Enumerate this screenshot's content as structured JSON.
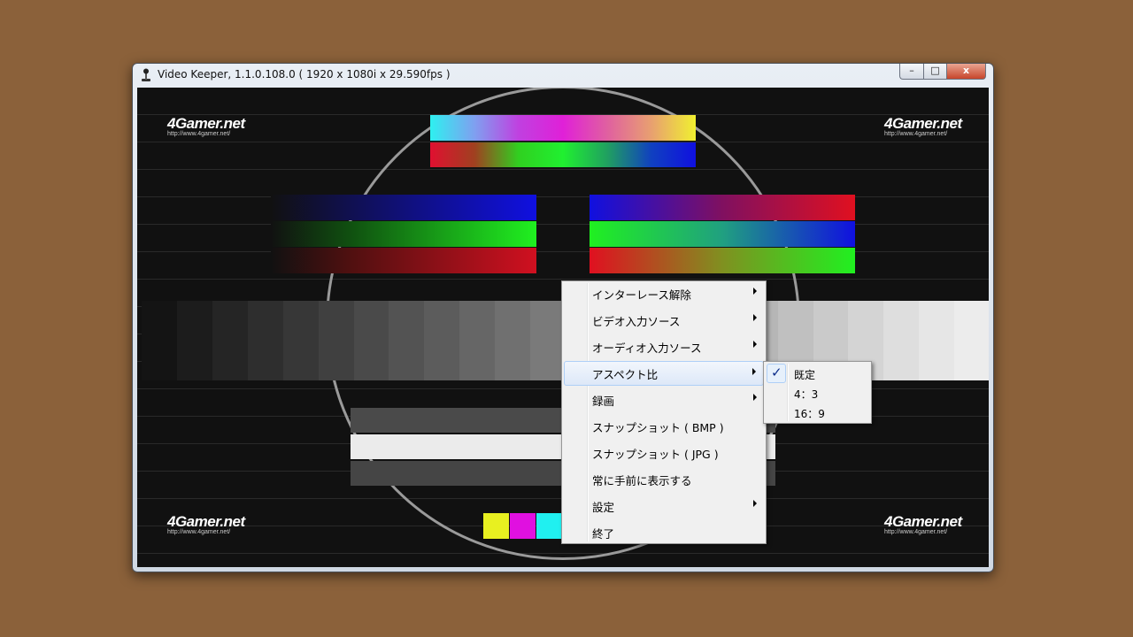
{
  "window": {
    "title": "Video Keeper, 1.1.0.108.0 ( 1920 x 1080i x 29.590fps )",
    "buttons": {
      "minimize": "–",
      "maximize": "□",
      "close": "x"
    }
  },
  "video": {
    "logo_text": "4Gamer.net",
    "logo_url": "http://www.4gamer.net/"
  },
  "context_menu": {
    "items": [
      {
        "label": "インターレース解除",
        "has_submenu": true
      },
      {
        "label": "ビデオ入力ソース",
        "has_submenu": true
      },
      {
        "label": "オーディオ入力ソース",
        "has_submenu": true
      },
      {
        "label": "アスペクト比",
        "has_submenu": true,
        "highlighted": true
      },
      {
        "label": "録画",
        "has_submenu": true
      },
      {
        "label": "スナップショット ( BMP )",
        "has_submenu": false
      },
      {
        "label": "スナップショット ( JPG )",
        "has_submenu": false
      },
      {
        "label": "常に手前に表示する",
        "has_submenu": false
      },
      {
        "label": "設定",
        "has_submenu": true
      },
      {
        "label": "終了",
        "has_submenu": false
      }
    ]
  },
  "aspect_submenu": {
    "items": [
      {
        "label": "既定",
        "checked": true
      },
      {
        "label": "4：3",
        "checked": false
      },
      {
        "label": "16：9",
        "checked": false
      }
    ]
  },
  "colors": {
    "desktop": "#8b613a",
    "menu_background": "#f0f0f0",
    "menu_highlight": "#dde8f8"
  }
}
